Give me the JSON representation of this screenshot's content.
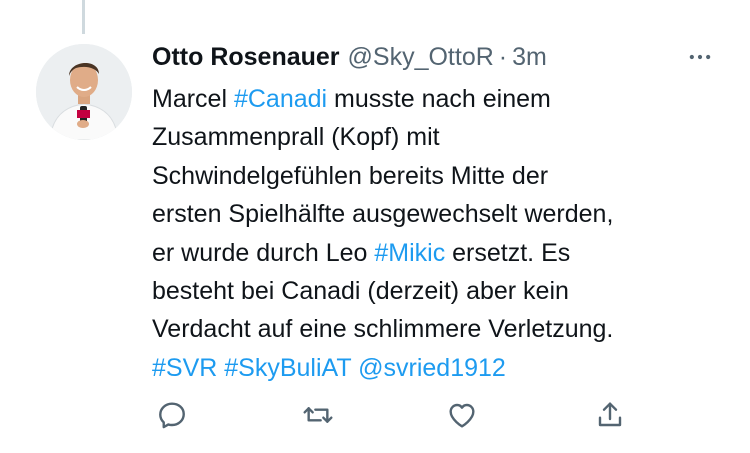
{
  "tweet": {
    "author_name": "Otto Rosenauer",
    "handle": "@Sky_OttoR",
    "separator": "·",
    "time": "3m",
    "lines": [
      [
        {
          "t": "Marcel "
        },
        {
          "t": "#Canadi",
          "link": true
        },
        {
          "t": " musste nach einem"
        }
      ],
      [
        {
          "t": "Zusammenprall (Kopf) mit"
        }
      ],
      [
        {
          "t": "Schwindelgefühlen bereits Mitte der"
        }
      ],
      [
        {
          "t": "ersten Spielhälfte ausgewechselt werden,"
        }
      ],
      [
        {
          "t": "er wurde durch Leo "
        },
        {
          "t": "#Mikic",
          "link": true
        },
        {
          "t": " ersetzt. Es"
        }
      ],
      [
        {
          "t": "besteht bei Canadi (derzeit) aber kein"
        }
      ],
      [
        {
          "t": "Verdacht auf eine schlimmere Verletzung."
        }
      ],
      [
        {
          "t": "#SVR",
          "link": true
        },
        {
          "t": " "
        },
        {
          "t": "#SkyBuliAT",
          "link": true
        },
        {
          "t": " "
        },
        {
          "t": "@svried1912",
          "link": true
        }
      ]
    ]
  },
  "icons": {
    "more": "more-horizontal-icon",
    "reply": "reply-icon",
    "retweet": "retweet-icon",
    "like": "like-icon",
    "share": "share-icon"
  },
  "colors": {
    "link": "#1d9bf0",
    "secondary_text": "#536471",
    "text": "#0f1419",
    "thread_line": "#cfd9de"
  }
}
